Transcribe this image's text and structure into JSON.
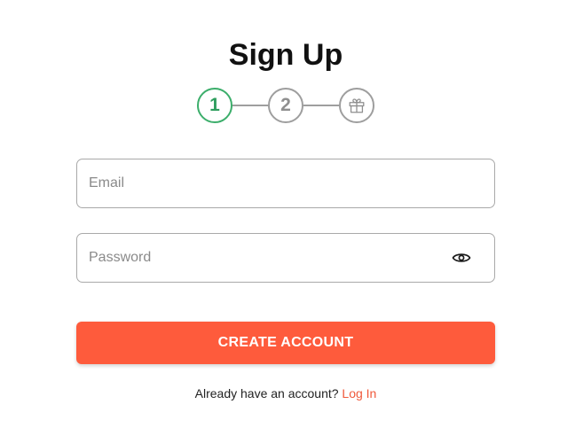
{
  "header": {
    "title": "Sign Up"
  },
  "stepper": {
    "steps": [
      {
        "label": "1",
        "state": "active"
      },
      {
        "label": "2",
        "state": "inactive"
      },
      {
        "icon": "gift-icon",
        "state": "inactive"
      }
    ],
    "active_color": "#3cae6b",
    "inactive_color": "#9e9e9e"
  },
  "form": {
    "email": {
      "placeholder": "Email",
      "value": ""
    },
    "password": {
      "placeholder": "Password",
      "value": "",
      "toggle_icon": "eye-icon"
    },
    "submit_label": "CREATE ACCOUNT",
    "submit_color": "#fe5b3c"
  },
  "footer": {
    "prompt": "Already have an account?",
    "link_label": "Log In",
    "link_color": "#f0583a"
  }
}
